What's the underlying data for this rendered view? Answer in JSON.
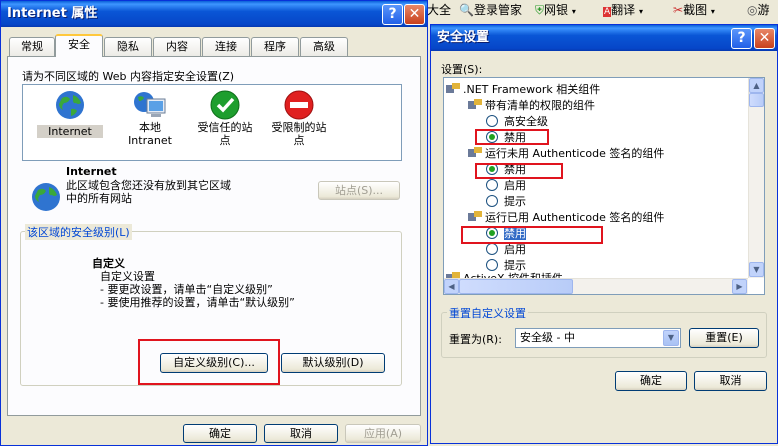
{
  "toolbar": {
    "item0": "大全",
    "item1": "登录管家",
    "item2": "网银",
    "item3": "翻译",
    "item4": "截图",
    "item5": "游"
  },
  "internet_options": {
    "title": "Internet 属性",
    "tabs": [
      "常规",
      "安全",
      "隐私",
      "内容",
      "连接",
      "程序",
      "高级"
    ],
    "prompt": "请为不同区域的 Web 内容指定安全设置(Z)",
    "zones": [
      {
        "label": "Internet",
        "icon": "globe-icon"
      },
      {
        "label": "本地\nIntranet",
        "icon": "intranet-monitor-icon"
      },
      {
        "label": "受信任的站\n点",
        "icon": "trusted-check-icon"
      },
      {
        "label": "受限制的站\n点",
        "icon": "restricted-no-icon"
      }
    ],
    "zone_info_title": "Internet",
    "zone_info_text": "此区域包含您还没有放到其它区域\n中的所有网站",
    "sites_button": "站点(S)...",
    "level_group_label": "该区域的安全级别(L)",
    "custom_title": "自定义",
    "custom_line1": "自定义设置",
    "custom_line2": "- 要更改设置，请单击“自定义级别”",
    "custom_line3": "- 要使用推荐的设置，请单击“默认级别”",
    "custom_level_button": "自定义级别(C)...",
    "default_level_button": "默认级别(D)",
    "ok": "确定",
    "cancel": "取消",
    "apply": "应用(A)"
  },
  "security_settings": {
    "title": "安全设置",
    "settings_label": "设置(S):",
    "tree": [
      {
        "type": "category",
        "text": ".NET Framework 相关组件"
      },
      {
        "type": "item",
        "text": "带有清单的权限的组件"
      },
      {
        "type": "radio",
        "text": "高安全级",
        "checked": false
      },
      {
        "type": "radio",
        "text": "禁用",
        "checked": true
      },
      {
        "type": "item",
        "text": "运行未用 Authenticode 签名的组件"
      },
      {
        "type": "radio",
        "text": "禁用",
        "checked": true
      },
      {
        "type": "radio",
        "text": "启用",
        "checked": false
      },
      {
        "type": "radio",
        "text": "提示",
        "checked": false
      },
      {
        "type": "item",
        "text": "运行已用 Authenticode 签名的组件"
      },
      {
        "type": "radio",
        "text": "禁用",
        "checked": true
      },
      {
        "type": "radio",
        "text": "启用",
        "checked": false
      },
      {
        "type": "radio",
        "text": "提示",
        "checked": false
      },
      {
        "type": "category",
        "text": "ActiveX 控件和插件"
      }
    ],
    "reset_group_label": "重置自定义设置",
    "reset_to_label": "重置为(R):",
    "reset_select_value": "安全级 - 中",
    "reset_button": "重置(E)",
    "ok": "确定",
    "cancel": "取消"
  }
}
